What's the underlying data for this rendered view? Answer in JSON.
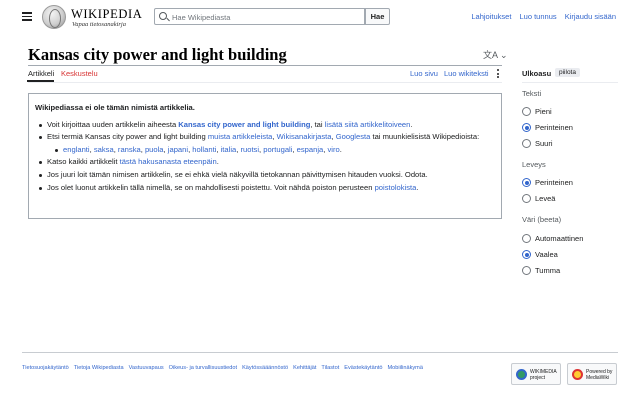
{
  "header": {
    "logo_word": "WIKIPEDIA",
    "logo_tagline": "Vapaa tietosanakirja",
    "search_placeholder": "Hae Wikipediasta",
    "search_button": "Hae",
    "user_links": [
      "Lahjoitukset",
      "Luo tunnus",
      "Kirjaudu sisään"
    ]
  },
  "page": {
    "title": "Kansas city power and light building",
    "lang_button": "文A ⌄",
    "tabs": {
      "article": "Artikkeli",
      "talk": "Keskustelu",
      "read": "Luo sivu",
      "source": "Luo wikiteksti"
    }
  },
  "notice": {
    "title": "Wikipediassa ei ole tämän nimistä artikkelia.",
    "item1": {
      "pre": "Voit kirjoittaa uuden artikkelin aiheesta ",
      "link_bold": "Kansas city power and light building",
      "mid": ", tai ",
      "link": "lisätä siitä artikkelitoiveen",
      "post": "."
    },
    "item2": {
      "pre": "Etsi termiä Kansas city power and light building ",
      "link1": "muista artikkeleista",
      "sep1": ", ",
      "link2": "Wikisanakirjasta",
      "sep2": ", ",
      "link3": "Googlesta",
      "post": " tai muunkielisistä Wikipedioista:"
    },
    "languages": [
      "englanti",
      "saksa",
      "ranska",
      "puola",
      "japani",
      "hollanti",
      "italia",
      "ruotsi",
      "portugali",
      "espanja",
      "viro"
    ],
    "item3": {
      "pre": "Katso kaikki artikkelit ",
      "link": "tästä hakusanasta eteenpäin",
      "post": "."
    },
    "item4": "Jos juuri loit tämän nimisen artikkelin, se ei ehkä vielä näkyvillä tietokannan päivittymisen hitauden vuoksi. Odota.",
    "item5": {
      "pre": "Jos olet luonut artikkelin tällä nimellä, se on mahdollisesti poistettu. Voit nähdä poiston perusteen ",
      "link": "poistolokista",
      "post": "."
    }
  },
  "sidebar": {
    "title": "Ulkoasu",
    "hide": "piilota",
    "text_label": "Teksti",
    "text_options": [
      "Pieni",
      "Perinteinen",
      "Suuri"
    ],
    "text_selected": "Perinteinen",
    "width_label": "Leveys",
    "width_options": [
      "Perinteinen",
      "Leveä"
    ],
    "width_selected": "Perinteinen",
    "color_label": "Väri (beeta)",
    "color_options": [
      "Automaattinen",
      "Vaalea",
      "Tumma"
    ],
    "color_selected": "Vaalea"
  },
  "footer": {
    "links": [
      "Tietosuojakäytäntö",
      "Tietoja Wikipediasta",
      "Vastuuvapaus",
      "Oikeus- ja turvallisuustiedot",
      "Käytössääännöstö",
      "Kehittäjät",
      "Tilastot",
      "Evästekäytäntö",
      "Mobiilinäkymä"
    ],
    "badge_wm": "WIKIMEDIA project",
    "badge_mw": "Powered by MediaWiki"
  },
  "colors": {
    "link": "#3366cc",
    "red_link": "#d73333",
    "border": "#a2a9b1"
  }
}
